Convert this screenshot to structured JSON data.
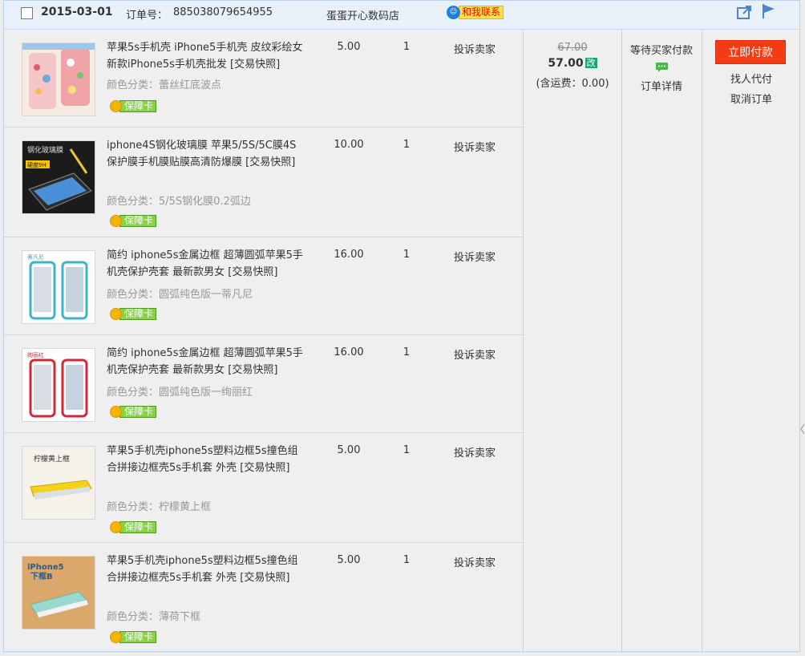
{
  "header": {
    "date": "2015-03-01",
    "order_label": "订单号：",
    "order_no": "885038079654955",
    "shop": "蛋蛋开心数码店",
    "contact": "和我联系"
  },
  "items": [
    {
      "title": "苹果5s手机壳 iPhone5手机壳 皮纹彩绘女新款iPhone5s手机壳批发 [交易快照]",
      "sku": "颜色分类：蕾丝红底波点",
      "guarantee": "保障卡",
      "price": "5.00",
      "qty": "1",
      "complain": "投诉卖家"
    },
    {
      "title": "iphone4S钢化玻璃膜 苹果5/5S/5C膜4S保护膜手机膜贴膜高清防爆膜 [交易快照]",
      "sku": "颜色分类：5/5S钢化膜0.2弧边",
      "guarantee": "保障卡",
      "price": "10.00",
      "qty": "1",
      "complain": "投诉卖家"
    },
    {
      "title": "简约 iphone5s金属边框 超薄圆弧苹果5手机壳保护壳套 最新款男女 [交易快照]",
      "sku": "颜色分类：圆弧纯色版一蒂凡尼",
      "guarantee": "保障卡",
      "price": "16.00",
      "qty": "1",
      "complain": "投诉卖家"
    },
    {
      "title": "简约 iphone5s金属边框 超薄圆弧苹果5手机壳保护壳套 最新款男女 [交易快照]",
      "sku": "颜色分类：圆弧纯色版一绚丽红",
      "guarantee": "保障卡",
      "price": "16.00",
      "qty": "1",
      "complain": "投诉卖家"
    },
    {
      "title": "苹果5手机壳iphone5s塑料边框5s撞色组合拼接边框壳5s手机套 外壳 [交易快照]",
      "sku": "颜色分类：柠檬黄上框",
      "guarantee": "保障卡",
      "price": "5.00",
      "qty": "1",
      "complain": "投诉卖家"
    },
    {
      "title": "苹果5手机壳iphone5s塑料边框5s撞色组合拼接边框壳5s手机套 外壳 [交易快照]",
      "sku": "颜色分类：薄荷下框",
      "guarantee": "保障卡",
      "price": "5.00",
      "qty": "1",
      "complain": "投诉卖家"
    }
  ],
  "thumbs": {
    "item2_banner": "钢化玻璃膜",
    "item2_badge": "硬度9H",
    "item3_label": "蒂凡尼",
    "item4_label": "绚丽红",
    "item5_label": "柠檬黄上框",
    "item6_label_1": "iPhone5",
    "item6_label_2": "下框B"
  },
  "totals": {
    "original": "67.00",
    "current": "57.00",
    "modify_badge": "改",
    "shipping": "(含运费：0.00)"
  },
  "status": {
    "text": "等待买家付款",
    "detail": "订单详情"
  },
  "actions": {
    "pay": "立即付款",
    "proxy": "找人代付",
    "cancel": "取消订单"
  },
  "colors": {
    "pay_button": "#f43c14",
    "header_bg": "#e8f1fa",
    "guarantee_green": "#8ad14a",
    "contact_yellow": "#ffe04a",
    "modify_green": "#1ca57a"
  }
}
